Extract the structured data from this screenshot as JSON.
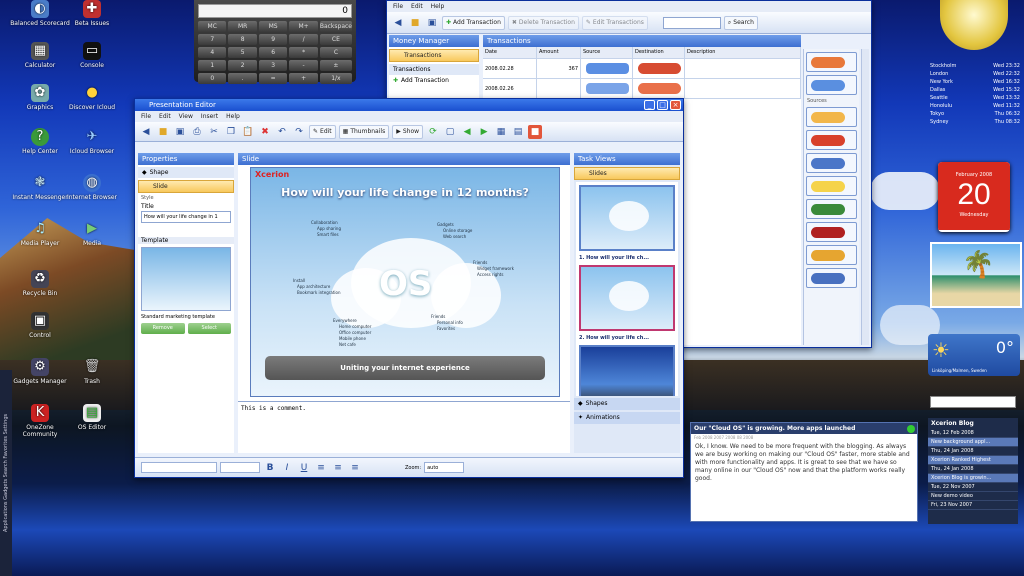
{
  "desktop": {
    "icons": [
      "Balanced Scorecard",
      "Beta Issues",
      "Calculator",
      "Console",
      "Graphics",
      "Discover Icloud",
      "Help Center",
      "Icloud Browser",
      "Instant Messenger",
      "Internet Browser",
      "Media Player",
      "Media",
      "Recycle Bin",
      "Control",
      "Gadgets Manager",
      "Trash",
      "OneZone Community",
      "OS Editor"
    ],
    "taskbar_vertical": "Applications  Gadgets  Search  Favorites  Settings"
  },
  "calculator": {
    "display": "0",
    "keys": [
      "MC",
      "MR",
      "MS",
      "M+",
      "Backspace",
      "7",
      "8",
      "9",
      "/",
      "CE",
      "4",
      "5",
      "6",
      "*",
      "C",
      "1",
      "2",
      "3",
      "-",
      "±",
      "0",
      ".",
      "=",
      "+",
      "1/x"
    ]
  },
  "money_manager": {
    "title": "Money Manager",
    "menu": [
      "File",
      "Edit",
      "Help"
    ],
    "toolbar": {
      "add": "Add Transaction",
      "delete": "Delete Transaction",
      "edit": "Edit Transactions",
      "search_label": "Search"
    },
    "nav": [
      "Transactions",
      "Transactions",
      "Add Transaction"
    ],
    "section_title": "Transactions",
    "columns": [
      "Date",
      "Amount",
      "Source",
      "Destination",
      "Description"
    ],
    "rows": [
      [
        "2008.02.28",
        "367",
        "",
        ""
      ],
      [
        "2008.02.26",
        "",
        "",
        ""
      ]
    ],
    "side_section": "Sources"
  },
  "presentation": {
    "title": "Presentation Editor",
    "menu": [
      "File",
      "Edit",
      "View",
      "Insert",
      "Help"
    ],
    "toolbar": {
      "edit": "Edit",
      "thumbnails": "Thumbnails",
      "show": "Show"
    },
    "properties_title": "Properties",
    "prop_items": [
      "Shape",
      "Slide"
    ],
    "style_label": "Style",
    "title_label": "Title",
    "title_value": "How will your life change in 1",
    "template_label": "Template",
    "template_name": "Standard marketing template",
    "btn_remove": "Remove",
    "btn_select": "Select",
    "slide_panel": "Slide",
    "slide_brand": "Xcerion",
    "slide_title": "How will your life change in 12 months?",
    "slide_logo": "OS",
    "slide_footer": "Uniting your internet experience",
    "bullets": [
      "Collaboration",
      "App sharing",
      "Smart files",
      "Gadgets",
      "Online storage",
      "Web search",
      "Friends",
      "Widget framework",
      "Access rights",
      "Install",
      "App architecture",
      "Bookmark integration",
      "Everywhere",
      "Home computer",
      "Office computer",
      "Mobile phone",
      "Net cafe",
      "Friends",
      "Personal info",
      "Favorites"
    ],
    "comment": "This is a comment.",
    "task_panel": "Task Views",
    "task_selected": "Slides",
    "thumbs": [
      "1. How will your life ch...",
      "2. How will your life ch...",
      "3."
    ],
    "task_footer": [
      "Shapes",
      "Animations"
    ],
    "status": {
      "zoom": "Zoom:",
      "zoom_val": "auto"
    }
  },
  "widgets": {
    "clocks": [
      [
        "Stockholm",
        "Wed 23:32"
      ],
      [
        "London",
        "Wed 22:32"
      ],
      [
        "New York",
        "Wed 16:32"
      ],
      [
        "Dallas",
        "Wed 15:32"
      ],
      [
        "Seattle",
        "Wed 13:32"
      ],
      [
        "Honolulu",
        "Wed 11:32"
      ],
      [
        "Tokyo",
        "Thu 06:32"
      ],
      [
        "Sydney",
        "Thu 08:32"
      ]
    ],
    "calendar": {
      "month": "February 2008",
      "day": "20",
      "weekday": "Wednesday"
    },
    "weather": {
      "temp": "0°",
      "place": "Linköping/Malmen, Sweden"
    },
    "blog": {
      "title": "Our \"Cloud OS\" is growing. More apps launched",
      "date": "Feb 2008 2007 2008 08 2008",
      "body": "Ok, I know. We need to be more frequent with the blogging. As always we are busy working on making our \"Cloud OS\" faster, more stable and with more functionality and apps. It is great to see that we have so many online in our \"Cloud OS\" now and that the platform works really good."
    },
    "news": {
      "title": "Xcerion Blog",
      "items": [
        "Tue, 12 Feb 2008",
        "New background appl...",
        "Thu, 24 Jan 2008",
        "Xcerion Ranked Highest",
        "Thu, 24 Jan 2008",
        "Xcerion Blog is growin...",
        "Tue, 22 Nov 2007",
        "New demo video",
        "Fri, 23 Nov 2007"
      ]
    }
  },
  "colors": {
    "accent": "#1a4fcf",
    "selection": "#f8c85c"
  }
}
